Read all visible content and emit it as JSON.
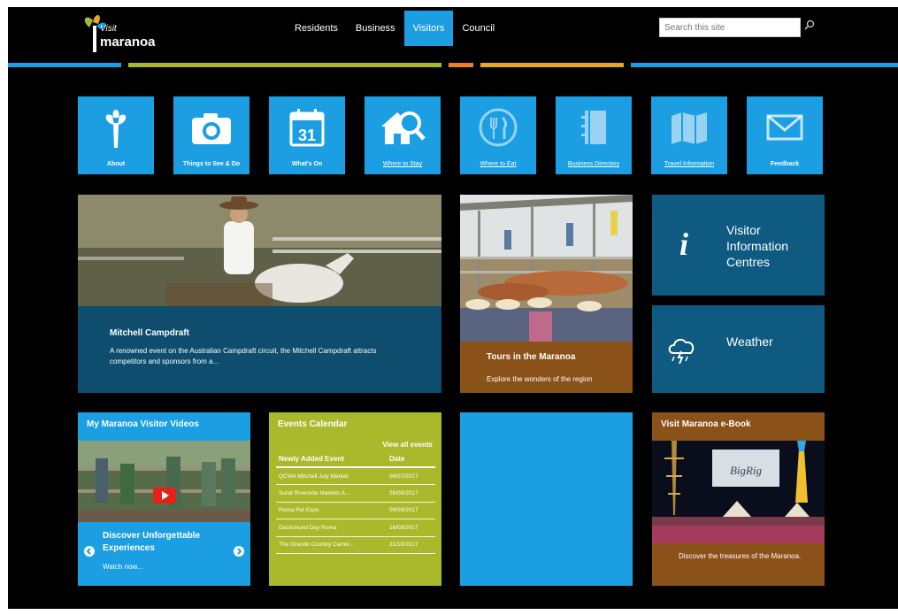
{
  "header": {
    "logo_line1": "Visit",
    "logo_line2": "maranoa",
    "nav": [
      "Residents",
      "Business",
      "Visitors",
      "Council"
    ],
    "active_nav": "Visitors",
    "search_placeholder": "Search this site"
  },
  "colors": {
    "tile_blue": "#1c9ee2",
    "dark_teal": "#0e5a80",
    "olive": "#a8ba2b",
    "brown": "#8a5118",
    "orange": "#e8822a"
  },
  "quick_tiles": [
    {
      "label": "About",
      "icon": "tree-icon"
    },
    {
      "label": "Things to See & Do",
      "icon": "camera-icon"
    },
    {
      "label": "What's On",
      "icon": "calendar-icon"
    },
    {
      "label": "Where to Stay",
      "icon": "house-search-icon"
    },
    {
      "label": "Where to Eat",
      "icon": "fork-knife-icon"
    },
    {
      "label": "Business Directory",
      "icon": "directory-icon"
    },
    {
      "label": "Travel Information",
      "icon": "map-icon"
    },
    {
      "label": "Feedback",
      "icon": "envelope-icon"
    }
  ],
  "feature": {
    "title": "Mitchell Campdraft",
    "description": "A renowned event on the Australian Campdraft circuit, the Mitchell Campdraft attracts competitors and sponsors from a..."
  },
  "tours": {
    "title": "Tours in the Maranoa",
    "description": "Explore the wonders of the region"
  },
  "visitor_centres": {
    "title": "Visitor Information Centres",
    "icon": "info-icon"
  },
  "weather": {
    "title": "Weather",
    "icon": "storm-cloud-icon"
  },
  "videos": {
    "header": "My Maranoa Visitor Videos",
    "caption": "Discover Unforgettable Experiences",
    "link": "Watch now..."
  },
  "events": {
    "header": "Events Calendar",
    "view_all": "View all events",
    "columns": [
      "Newly Added Event",
      "Date"
    ],
    "rows": [
      [
        "QCWA Mitchell July Market",
        "08/07/2017"
      ],
      [
        "Surat Riverside Markets A...",
        "26/08/2017"
      ],
      [
        "Roma Pet Expo",
        "09/09/2017"
      ],
      [
        "Dachshund Day Roma",
        "16/09/2017"
      ],
      [
        "The Grande Country Carniv...",
        "21/10/2017"
      ]
    ]
  },
  "ebook": {
    "header": "Visit Maranoa e-Book",
    "sign": "BigRig",
    "caption": "Discover the treasures of the Maranoa."
  }
}
